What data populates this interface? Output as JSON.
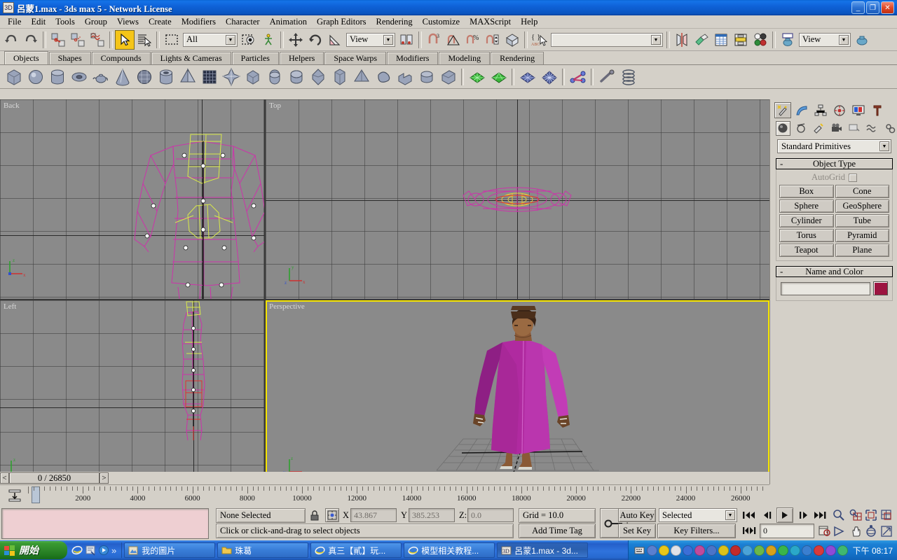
{
  "window": {
    "title": "呂蒙1.max - 3ds max 5 - Network License",
    "icon": "max-app-icon",
    "buttons": {
      "minimize": "_",
      "maximize": "❐",
      "close": "✕"
    }
  },
  "menu": {
    "items": [
      "File",
      "Edit",
      "Tools",
      "Group",
      "Views",
      "Create",
      "Modifiers",
      "Character",
      "Animation",
      "Graph Editors",
      "Rendering",
      "Customize",
      "MAXScript",
      "Help"
    ]
  },
  "toolbar": {
    "selection_filter": "All",
    "reference_coord": "View",
    "named_selection_set": "",
    "viewport_layout": "View",
    "buttons": [
      {
        "name": "undo-button",
        "label": "Undo"
      },
      {
        "name": "redo-button",
        "label": "Redo"
      },
      {
        "name": "select-and-link-button",
        "label": "Select and Link"
      },
      {
        "name": "unlink-selection-button",
        "label": "Unlink Selection"
      },
      {
        "name": "bind-to-space-warp-button",
        "label": "Bind to Space Warp"
      },
      {
        "name": "select-object-button",
        "label": "Select Object"
      },
      {
        "name": "select-by-name-button",
        "label": "Select by Name"
      },
      {
        "name": "rectangular-selection-region-button",
        "label": "Rectangular Selection Region"
      },
      {
        "name": "window-crossing-button",
        "label": "Window / Crossing"
      },
      {
        "name": "select-and-move-button",
        "label": "Select and Move"
      },
      {
        "name": "select-and-rotate-button",
        "label": "Select and Rotate"
      },
      {
        "name": "select-and-scale-button",
        "label": "Select and Uniform Scale"
      },
      {
        "name": "use-center-flyout-button",
        "label": "Use Pivot Point Center"
      },
      {
        "name": "mirror-button",
        "label": "Mirror Selected Objects"
      },
      {
        "name": "align-button",
        "label": "Align"
      },
      {
        "name": "layer-manager-button",
        "label": "Layer Manager"
      },
      {
        "name": "curve-editor-button",
        "label": "Open Curve Editor"
      },
      {
        "name": "schematic-view-button",
        "label": "Open Schematic View"
      },
      {
        "name": "material-editor-button",
        "label": "Material Editor"
      },
      {
        "name": "render-scene-button",
        "label": "Render Scene"
      },
      {
        "name": "quick-render-button",
        "label": "Quick Render"
      },
      {
        "name": "array-button",
        "label": "Array"
      },
      {
        "name": "snap-toggle-button",
        "label": "3D Snap Toggle"
      },
      {
        "name": "angle-snap-button",
        "label": "Angle Snap Toggle"
      },
      {
        "name": "percent-snap-button",
        "label": "Percent Snap Toggle"
      },
      {
        "name": "spinner-snap-button",
        "label": "Spinner Snap Toggle"
      },
      {
        "name": "named-selection-sets-button",
        "label": "Named Selection Sets"
      }
    ]
  },
  "tabpanel": {
    "tabs": [
      {
        "label": "Objects",
        "active": true
      },
      {
        "label": "Shapes",
        "active": false
      },
      {
        "label": "Compounds",
        "active": false
      },
      {
        "label": "Lights & Cameras",
        "active": false
      },
      {
        "label": "Particles",
        "active": false
      },
      {
        "label": "Helpers",
        "active": false
      },
      {
        "label": "Space Warps",
        "active": false
      },
      {
        "label": "Modifiers",
        "active": false
      },
      {
        "label": "Modeling",
        "active": false
      },
      {
        "label": "Rendering",
        "active": false
      }
    ],
    "object_icons": [
      "box-icon",
      "sphere-icon",
      "cylinder-icon",
      "torus-icon",
      "teapot-icon",
      "cone-icon",
      "geosphere-icon",
      "tube-icon",
      "pyramid-icon",
      "plane-icon",
      "hedra-icon",
      "chamferbox-icon",
      "capsule-icon",
      "oiltank-icon",
      "spindle-icon",
      "gengon-icon",
      "prism-icon",
      "torusknot-icon",
      "l-extrusion-icon",
      "chamfercyl-icon",
      "c-extrusion-icon",
      "quadpatch-icon",
      "tripatch-icon",
      "nurbs-plane-icon",
      "nurbs-surface-icon",
      "bones-icon",
      "ik-chain-icon",
      "spring-icon"
    ]
  },
  "viewports": [
    {
      "name": "viewport-back",
      "label": "Back",
      "active": false
    },
    {
      "name": "viewport-top",
      "label": "Top",
      "active": false
    },
    {
      "name": "viewport-left",
      "label": "Left",
      "active": false
    },
    {
      "name": "viewport-perspective",
      "label": "Perspective",
      "active": true
    }
  ],
  "command_panel": {
    "tabs": [
      "create-tab",
      "modify-tab",
      "hierarchy-tab",
      "motion-tab",
      "display-tab",
      "utilities-tab"
    ],
    "subtabs": [
      "geometry-subtab",
      "shapes-subtab",
      "lights-subtab",
      "cameras-subtab",
      "helpers-subtab",
      "space-warps-subtab",
      "systems-subtab"
    ],
    "category": "Standard Primitives",
    "object_type": {
      "title": "Object Type",
      "autogrid_label": "AutoGrid",
      "autogrid_checked": false,
      "buttons": [
        "Box",
        "Cone",
        "Sphere",
        "GeoSphere",
        "Cylinder",
        "Tube",
        "Torus",
        "Pyramid",
        "Teapot",
        "Plane"
      ]
    },
    "name_and_color": {
      "title": "Name and Color",
      "name_value": "",
      "color": "#9c1440"
    }
  },
  "timeline": {
    "current_frame_display": "0 / 26850",
    "prev_label": "<",
    "next_label": ">",
    "handle_label": "0",
    "ticks": [
      0,
      2000,
      4000,
      6000,
      8000,
      10000,
      12000,
      14000,
      16000,
      18000,
      20000,
      22000,
      24000,
      26000
    ],
    "range_max": 26850
  },
  "status": {
    "selection_text": "None Selected",
    "lock_icon": "lock-selection-icon",
    "coordinate_icon": "absolute-relative-toggle-icon",
    "x_label": "X",
    "x_value": "43.867",
    "y_label": "Y",
    "y_value": "385.253",
    "z_label": "Z:",
    "z_value": "0.0",
    "grid_text": "Grid = 10.0",
    "prompt_text": "Click or click-and-drag to select objects",
    "add_time_tag": "Add Time Tag",
    "key_mode_icon": "key-mode-toggle-icon"
  },
  "animation": {
    "auto_key": "Auto Key",
    "set_key": "Set Key",
    "key_filter_mode": "Selected",
    "key_filters": "Key Filters...",
    "frame_field": "0",
    "playback": [
      {
        "name": "goto-start-button",
        "label": "|◀◀"
      },
      {
        "name": "previous-frame-button",
        "label": "◀|"
      },
      {
        "name": "play-animation-button",
        "label": "▶"
      },
      {
        "name": "next-frame-button",
        "label": "|▶"
      },
      {
        "name": "goto-end-button",
        "label": "▶▶|"
      },
      {
        "name": "key-mode-toggle-button",
        "label": "|◀▶|"
      }
    ],
    "nav_icons": [
      "zoom-icon",
      "zoom-all-icon",
      "zoom-extents-icon",
      "zoom-extents-all-icon",
      "field-of-view-icon",
      "pan-icon",
      "arc-rotate-icon",
      "min-max-toggle-icon"
    ]
  },
  "taskbar": {
    "start_label": "開始",
    "quick_launch": [
      "internet-explorer-icon",
      "show-desktop-icon",
      "media-player-icon",
      "chevron-double-right-icon"
    ],
    "items": [
      {
        "label": "我的圖片",
        "icon": "pictures-folder-icon",
        "active": false
      },
      {
        "label": "珠葛",
        "icon": "folder-icon",
        "active": false
      },
      {
        "label": "真三【貳】玩...",
        "icon": "internet-explorer-icon",
        "active": false
      },
      {
        "label": "模型相关教程...",
        "icon": "internet-explorer-icon",
        "active": false
      },
      {
        "label": "呂蒙1.max - 3d...",
        "icon": "max-app-icon",
        "active": true
      }
    ],
    "tray_colors": [
      "#5a7fd0",
      "#e8c71a",
      "#dfe2e8",
      "#3b6fd8",
      "#c04a9c",
      "#4b74c9",
      "#dcc21a",
      "#c32b2b",
      "#4aa3d8",
      "#6ab84a",
      "#d8a11a",
      "#39b54a",
      "#2aa8c9",
      "#3a7fd0",
      "#d83b3b",
      "#8e4ad8",
      "#3fb870"
    ],
    "time": "下午 08:17"
  }
}
